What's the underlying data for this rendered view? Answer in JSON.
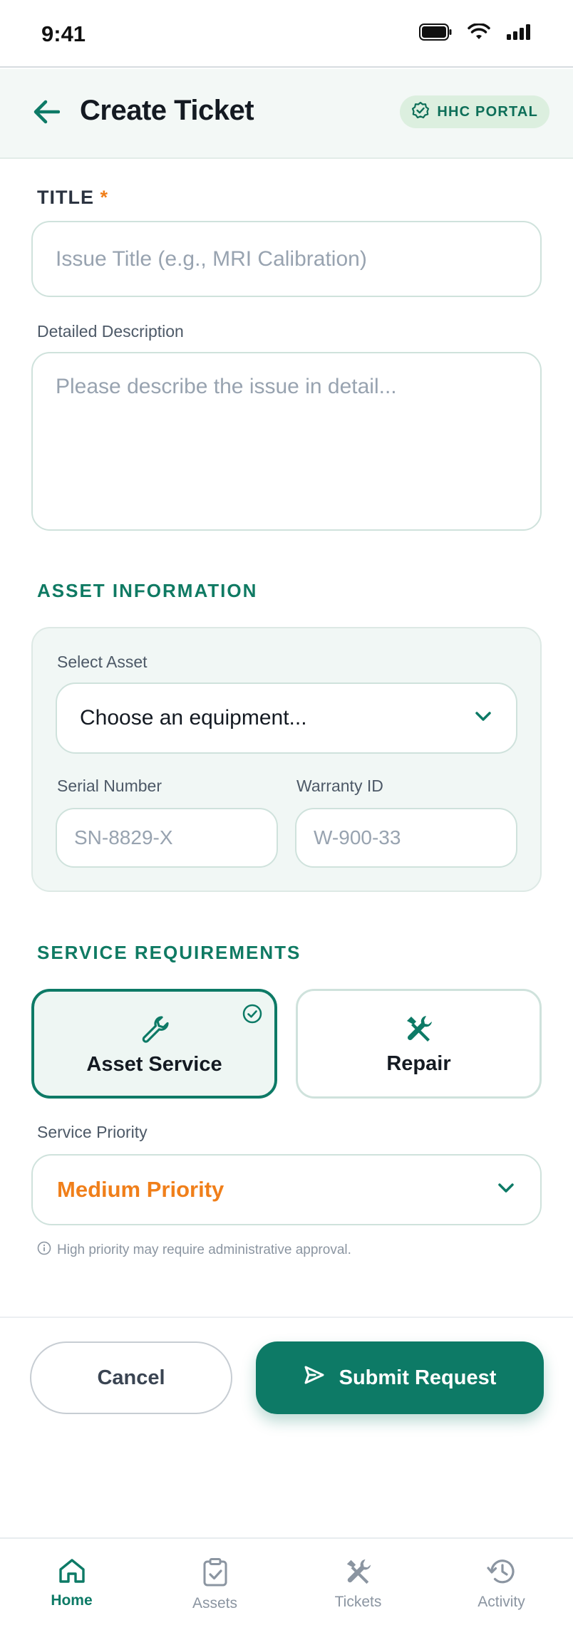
{
  "status_bar": {
    "time": "9:41"
  },
  "header": {
    "title": "Create Ticket",
    "badge": "HHC PORTAL"
  },
  "form": {
    "title_label": "TITLE",
    "required_mark": "*",
    "title_placeholder": "Issue Title (e.g., MRI Calibration)",
    "description_label": "Detailed Description",
    "description_placeholder": "Please describe the issue in detail..."
  },
  "asset_info": {
    "section_title": "ASSET INFORMATION",
    "select_label": "Select Asset",
    "select_value": "Choose an equipment...",
    "serial_label": "Serial Number",
    "serial_placeholder": "SN-8829-X",
    "warranty_label": "Warranty ID",
    "warranty_placeholder": "W-900-33"
  },
  "service": {
    "section_title": "SERVICE REQUIREMENTS",
    "options": [
      {
        "label": "Asset Service",
        "icon": "wrench-icon",
        "selected": true
      },
      {
        "label": "Repair",
        "icon": "tools-icon",
        "selected": false
      }
    ],
    "priority_label": "Service Priority",
    "priority_value": "Medium Priority",
    "hint": "High priority may require administrative approval."
  },
  "actions": {
    "cancel": "Cancel",
    "submit": "Submit Request"
  },
  "nav": [
    {
      "label": "Home",
      "icon": "home-icon",
      "active": true
    },
    {
      "label": "Assets",
      "icon": "clipboard-check-icon",
      "active": false
    },
    {
      "label": "Tickets",
      "icon": "tools-icon",
      "active": false
    },
    {
      "label": "Activity",
      "icon": "history-icon",
      "active": false
    }
  ],
  "colors": {
    "primary": "#0d7a66",
    "accent_orange": "#f07f1a",
    "header_bg": "#f3f8f6",
    "badge_bg": "#dcefdf"
  }
}
